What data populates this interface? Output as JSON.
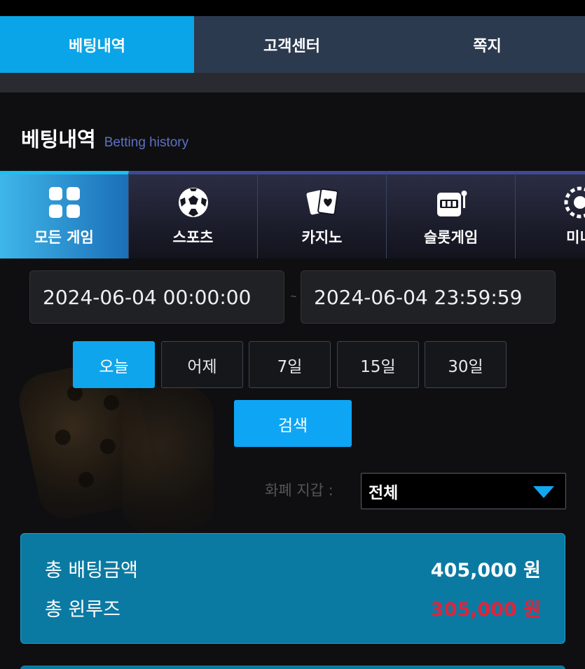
{
  "tabs": [
    "베팅내역",
    "고객센터",
    "쪽지"
  ],
  "title": {
    "ko": "베팅내역",
    "en": "Betting history"
  },
  "categories": [
    {
      "label": "모든 게임",
      "icon": "grid-icon"
    },
    {
      "label": "스포츠",
      "icon": "soccer-ball-icon"
    },
    {
      "label": "카지노",
      "icon": "playing-cards-icon"
    },
    {
      "label": "슬롯게임",
      "icon": "slot-machine-icon"
    },
    {
      "label": "미니",
      "icon": "mini-game-icon"
    }
  ],
  "dates": {
    "from": "2024-06-04 00:00:00",
    "separator": "~",
    "to": "2024-06-04 23:59:59"
  },
  "quick_ranges": [
    "오늘",
    "어제",
    "7일",
    "15일",
    "30일"
  ],
  "search_label": "검색",
  "wallet": {
    "label": "화폐 지갑 :",
    "selected": "전체"
  },
  "summary": {
    "total_bet_label": "총 배팅금액",
    "total_bet_value": "405,000 원",
    "total_win_label": "총 윈루즈",
    "total_win_value": "305,000 원"
  },
  "colors": {
    "accent": "#0ea5ec",
    "tab_bg": "#2c3a4f",
    "summary_bg": "#0b7aa3",
    "negative": "#e0243a"
  }
}
